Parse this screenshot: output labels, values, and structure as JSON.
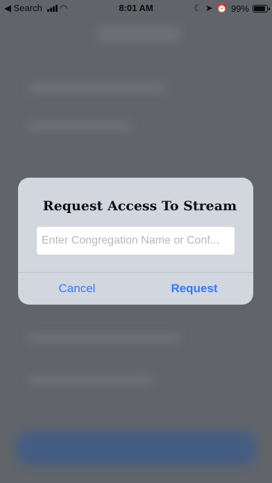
{
  "status_bar": {
    "back_label": "◀ Search",
    "time": "8:01 AM",
    "battery": "99%"
  },
  "dialog": {
    "title": "Request Access To Stream",
    "input": {
      "value": "",
      "placeholder": "Enter Congregation Name or Conf..."
    },
    "cancel_label": "Cancel",
    "request_label": "Request"
  },
  "colors": {
    "accent": "#2f7cf6",
    "dialog_bg": "#d2d6de",
    "dimmed_bg": "#616569"
  }
}
